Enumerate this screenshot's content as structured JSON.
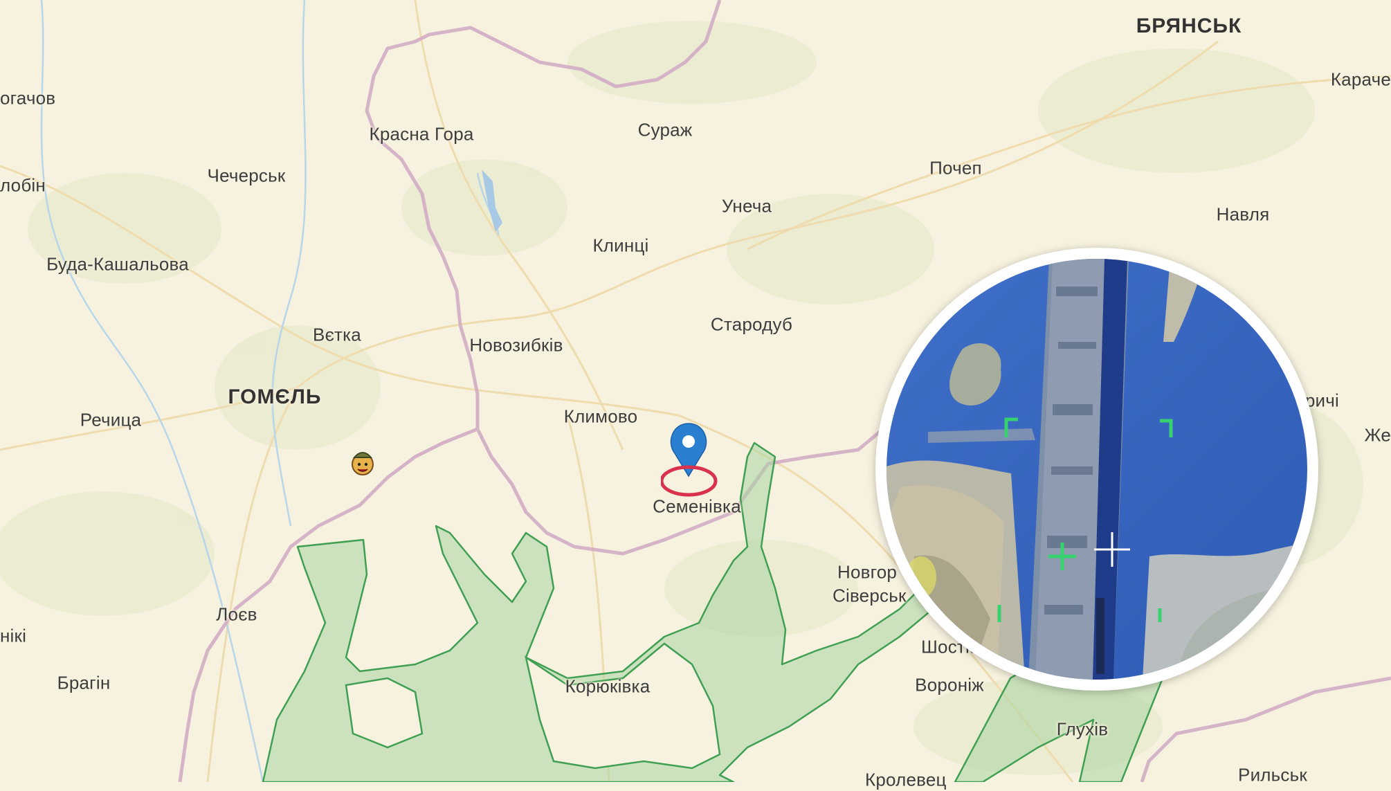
{
  "map": {
    "labels": {
      "bryansk": "БРЯНСЬК",
      "karachev": "Караче",
      "rogachov": "огачов",
      "krasna_gora": "Красна Гора",
      "surazh": "Сураж",
      "pochep": "Почеп",
      "chechersk": "Чечерськ",
      "zhlobin": "лобін",
      "unecha": "Унеча",
      "navlya": "Навля",
      "buda": "Буда-Кашальова",
      "klintsy": "Клинці",
      "starodub": "Стародуб",
      "vetka": "Вєтка",
      "novozybkov": "Новозибків",
      "gomel": "ГОМЄЛЬ",
      "rechitsa": "Речица",
      "klimovo": "Климово",
      "semenivka": "Семенівка",
      "novgorod_1": "Новгор",
      "novgorod_2": "Сіверськ",
      "loev": "Лоєв",
      "niki": "нікі",
      "bragin": "Брагін",
      "koryukivka": "Корюківка",
      "shostka": "Шостк",
      "voronizh": "Воронiж",
      "glukhiv": "Глухів",
      "rylsk": "Рильськ",
      "krolevets": "Кролевец",
      "trubchevsk_part": "ричі",
      "zhe_part": "Же"
    },
    "marker_icon": "location-pin-icon",
    "highlight_icon": "target-ellipse-icon",
    "unit_icon": "soldier-icon",
    "colors": {
      "land": "#f7f2df",
      "zone_fill": "#a9d6a3",
      "zone_stroke": "#3f9f52",
      "border": "#d0a9c3",
      "pin": "#2b7fd1",
      "highlight": "#d8324e",
      "water": "#a7c9e6"
    }
  },
  "inset": {
    "description_icon": "drone-footage-bridge-icon",
    "colors": {
      "water": "#3b68c4",
      "bridge": "#7e8fa8",
      "bank": "#b9b8a9",
      "hud": "#35d26e"
    }
  }
}
